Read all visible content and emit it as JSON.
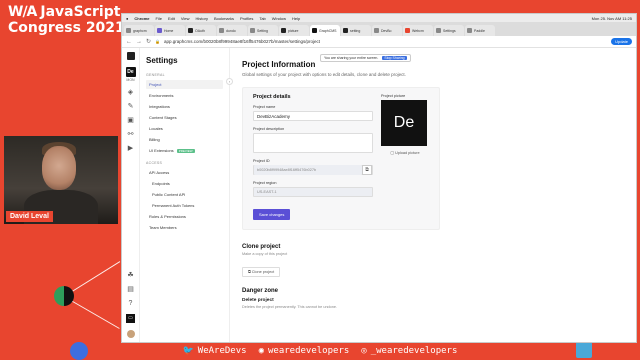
{
  "conference": {
    "logo": "W∕A",
    "title_line1": "JavaScript",
    "title_line2": "Congress 2021"
  },
  "speaker": {
    "name": "David Leval"
  },
  "social": {
    "items": [
      {
        "icon": "twitter-icon",
        "text": "WeAreDevs"
      },
      {
        "icon": "github-icon",
        "text": "wearedevelopers"
      },
      {
        "icon": "instagram-icon",
        "text": "_wearedevelopers"
      }
    ]
  },
  "browser": {
    "menubar": [
      "Chrome",
      "File",
      "Edit",
      "View",
      "History",
      "Bookmarks",
      "Profiles",
      "Tab",
      "Window",
      "Help"
    ],
    "menubar_right": "Mon 25. Nov  AM 11:25",
    "tabs": [
      "graphcm",
      "Home",
      "OAuth",
      "dundo",
      "Setting",
      "picture",
      "GraphCMS",
      "setting",
      "DevBo",
      "Webcm",
      "Settings",
      "Paddle"
    ],
    "active_tab_index": 6,
    "url": "app.graphcms.com/b0020b8f99948ae8f16ff5476b027b/master/settings/project",
    "update_label": "Update",
    "share_text": "You are sharing your entire screen.",
    "share_stop": "Stop Sharing"
  },
  "rail": {
    "project_initials": "De",
    "project_label": "MON"
  },
  "sidebar": {
    "title": "Settings",
    "general_label": "GENERAL",
    "general_items": [
      "Project",
      "Environments",
      "Integrations",
      "Content Stages",
      "Locales",
      "Billing",
      "UI Extensions"
    ],
    "ui_extensions_badge": "PREVIEW",
    "access_label": "ACCESS",
    "api_access": "API Access",
    "api_sub": [
      "Endpoints",
      "Public Content API",
      "Permanent Auth Tokens"
    ],
    "access_items": [
      "Roles & Permissions",
      "Team Members"
    ]
  },
  "main": {
    "title": "Project Information",
    "description": "Global settings of your project with options to edit details, clone and delete project.",
    "details": {
      "heading": "Project details",
      "name_label": "Project name",
      "name_value": "DevBizAcademy",
      "desc_label": "Project description",
      "id_label": "Project ID",
      "id_value": "b0020b8f99948ae8f16ff5476b027b",
      "region_label": "Project region",
      "region_value": "US-EAST-1",
      "save_label": "Save changes",
      "picture_label": "Project picture",
      "picture_initials": "De",
      "upload_label": "Upload picture"
    },
    "clone": {
      "heading": "Clone project",
      "description": "Make a copy of this project",
      "button": "Clone project"
    },
    "danger": {
      "heading": "Danger zone",
      "delete_title": "Delete project",
      "delete_desc": "Deletes the project permanently. This cannot be undone."
    }
  }
}
